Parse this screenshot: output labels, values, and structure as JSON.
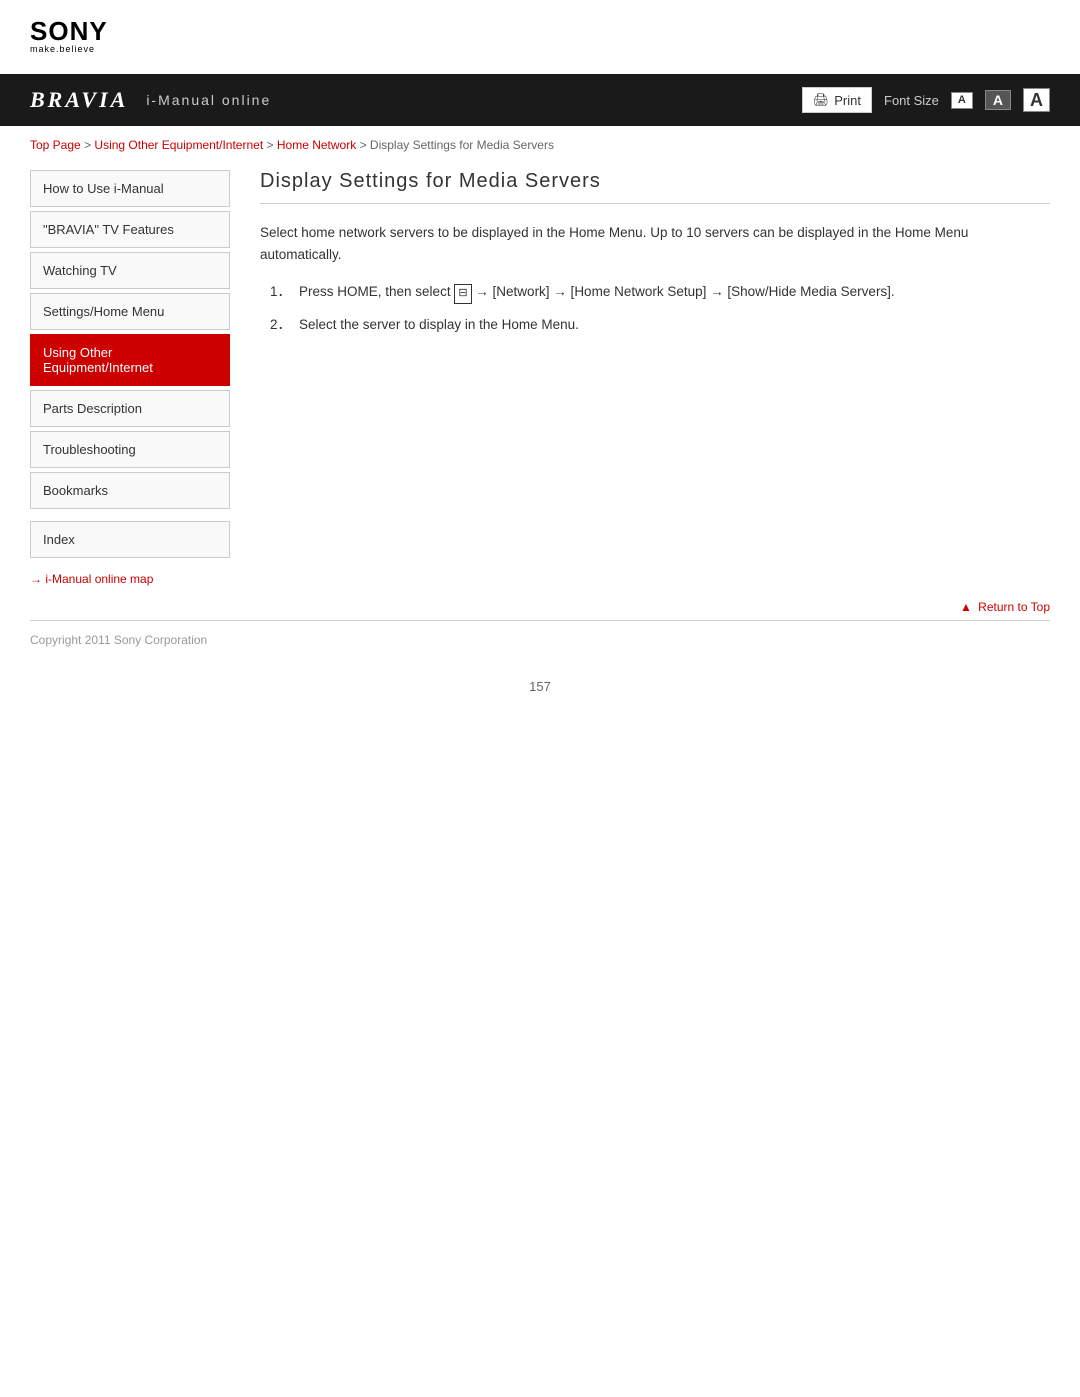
{
  "logo": {
    "brand": "SONY",
    "tagline": "make.believe"
  },
  "header": {
    "bravia_label": "BRAVIA",
    "imanual_label": "i-Manual online",
    "print_label": "Print",
    "font_size_label": "Font Size",
    "font_btn_sm": "A",
    "font_btn_md": "A",
    "font_btn_lg": "A"
  },
  "breadcrumb": {
    "items": [
      {
        "label": "Top Page",
        "link": true
      },
      {
        "label": "Using Other Equipment/Internet",
        "link": true
      },
      {
        "label": "Home Network",
        "link": true
      },
      {
        "label": "Display Settings for Media Servers",
        "link": false
      }
    ],
    "separator": ">"
  },
  "sidebar": {
    "items": [
      {
        "label": "How to Use i-Manual",
        "active": false
      },
      {
        "label": "\"BRAVIA\" TV Features",
        "active": false
      },
      {
        "label": "Watching TV",
        "active": false
      },
      {
        "label": "Settings/Home Menu",
        "active": false
      },
      {
        "label": "Using Other Equipment/Internet",
        "active": true
      },
      {
        "label": "Parts Description",
        "active": false
      },
      {
        "label": "Troubleshooting",
        "active": false
      },
      {
        "label": "Bookmarks",
        "active": false
      }
    ],
    "index_label": "Index",
    "map_link_label": "i-Manual online map"
  },
  "content": {
    "title": "Display Settings for Media Servers",
    "intro": "Select home network servers to be displayed in the Home Menu. Up to 10 servers can be displayed in the Home Menu automatically.",
    "steps": [
      {
        "number": "1．",
        "text": "Press HOME, then select  → [Network] → [Home Network Setup] → [Show/Hide Media Servers]."
      },
      {
        "number": "2．",
        "text": "Select the server to display in the Home Menu."
      }
    ]
  },
  "footer": {
    "return_top_label": "Return to Top",
    "copyright": "Copyright 2011 Sony Corporation",
    "page_number": "157"
  }
}
